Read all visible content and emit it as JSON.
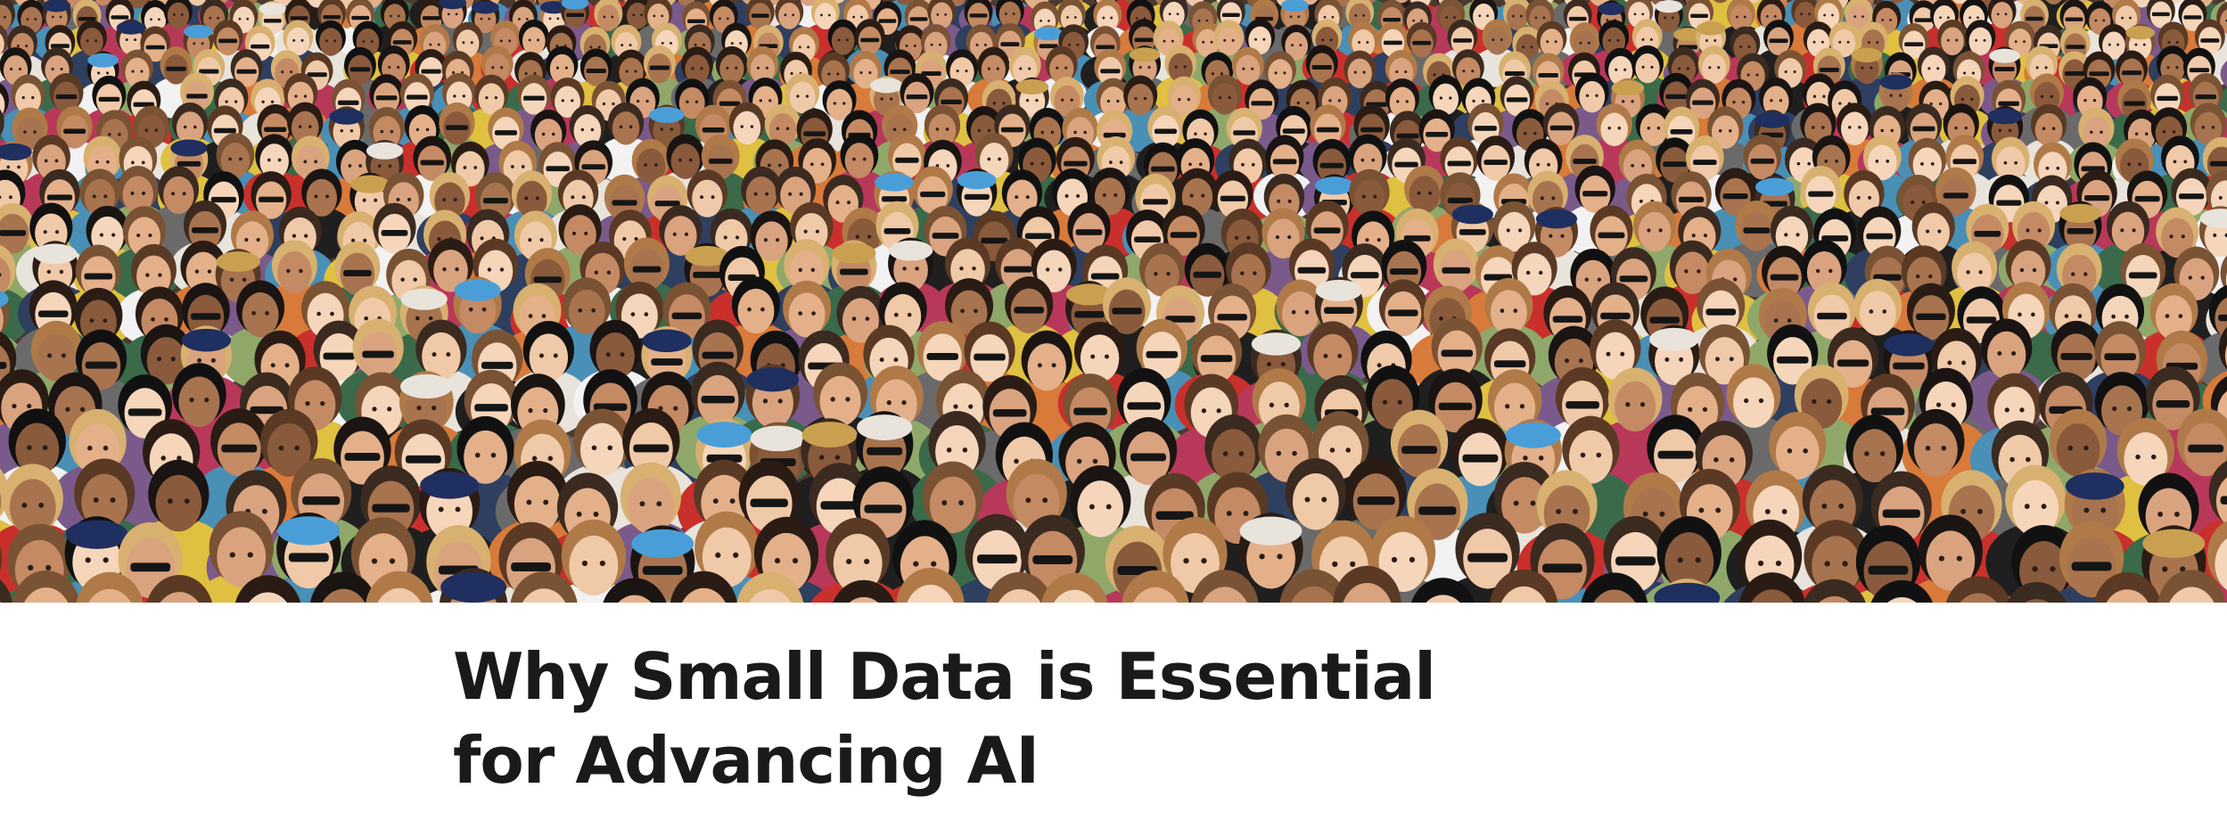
{
  "hero_image": {
    "description_icon": "crowd-photo",
    "palette": [
      "#3b2a20",
      "#6b4a36",
      "#a8734f",
      "#d9a37f",
      "#f0c9a8",
      "#2f3f5f",
      "#c9302c",
      "#e8e4dc",
      "#1f1f1f",
      "#4a8fb5",
      "#8fa86a",
      "#7a5a8a"
    ]
  },
  "article": {
    "title": "Why Small Data is Essential for Advancing AI",
    "title_color": "#1a1a1a"
  }
}
